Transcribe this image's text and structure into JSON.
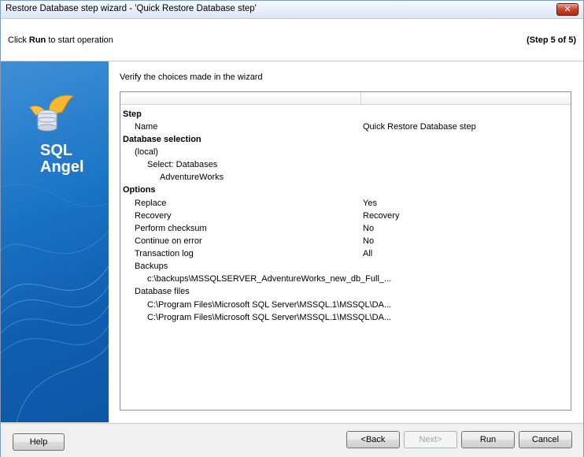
{
  "window": {
    "title": "Restore Database step wizard - 'Quick Restore Database step'",
    "close_label": "✕"
  },
  "header": {
    "instruction_prefix": "Click ",
    "instruction_bold": "Run",
    "instruction_suffix": " to start operation",
    "step_indicator": "(Step 5 of 5)"
  },
  "logo": {
    "line1": "SQL",
    "line2": "Angel"
  },
  "content": {
    "verify_text": "Verify the choices made in the wizard",
    "rows": {
      "step": "Step",
      "name_label": "Name",
      "name_value": "Quick Restore Database step",
      "db_selection": "Database selection",
      "local": "(local)",
      "select_databases": "Select: Databases",
      "adventureworks": "AdventureWorks",
      "options": "Options",
      "replace_label": "Replace",
      "replace_value": "Yes",
      "recovery_label": "Recovery",
      "recovery_value": "Recovery",
      "checksum_label": "Perform checksum",
      "checksum_value": "No",
      "continue_label": "Continue on error",
      "continue_value": "No",
      "txlog_label": "Transaction log",
      "txlog_value": "All",
      "backups_label": "Backups",
      "backup_path": "c:\\backups\\MSSQLSERVER_AdventureWorks_new_db_Full_...",
      "dbfiles_label": "Database files",
      "dbfile1": "C:\\Program Files\\Microsoft SQL Server\\MSSQL.1\\MSSQL\\DA...",
      "dbfile2": "C:\\Program Files\\Microsoft SQL Server\\MSSQL.1\\MSSQL\\DA..."
    }
  },
  "footer": {
    "help": "Help",
    "back": "<Back",
    "next": "Next>",
    "run": "Run",
    "cancel": "Cancel"
  }
}
